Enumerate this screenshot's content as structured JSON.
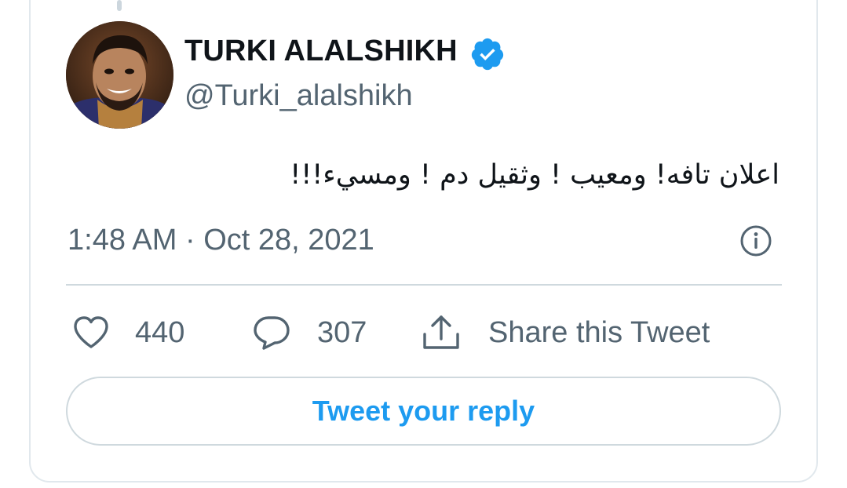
{
  "author": {
    "display_name": "TURKI ALALSHIKH",
    "handle": "@Turki_alalshikh",
    "verified": true
  },
  "tweet": {
    "text": "اعلان تافه! ومعيب ! وثقيل دم ! ومسيء!!!",
    "timestamp": "1:48 AM · Oct 28, 2021"
  },
  "actions": {
    "like_count": "440",
    "reply_count": "307",
    "share_label": "Share this Tweet",
    "reply_button_label": "Tweet your reply"
  },
  "icons": {
    "verified": "verified-badge-icon",
    "info": "info-icon",
    "like": "heart-icon",
    "reply": "speech-bubble-icon",
    "share": "share-upload-icon"
  },
  "colors": {
    "accent": "#1d9bf0",
    "text_primary": "#0f1419",
    "text_secondary": "#536471",
    "border": "#cfd9de"
  }
}
